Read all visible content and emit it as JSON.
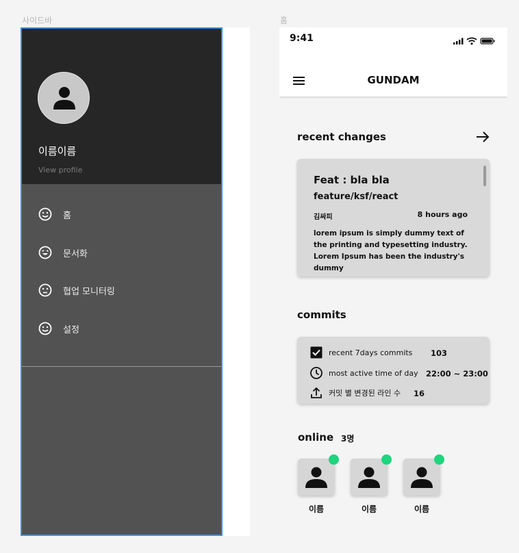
{
  "frames": {
    "sidebar_label": "사이드바",
    "home_label": "홈"
  },
  "sidebar": {
    "name": "이름이름",
    "view_profile": "View profile",
    "items": [
      {
        "label": "홈",
        "icon": "smile-icon"
      },
      {
        "label": "문서화",
        "icon": "smile-icon"
      },
      {
        "label": "협업 모니터링",
        "icon": "neutral-face-icon"
      },
      {
        "label": "설정",
        "icon": "smile-icon"
      }
    ]
  },
  "home": {
    "status_time": "9:41",
    "app_title": "GUNDAM",
    "recent": {
      "title": "recent changes",
      "card": {
        "commit_title": "Feat : bla bla",
        "branch": "feature/ksf/react",
        "author": "김싸피",
        "time": "8 hours ago",
        "body": "lorem ipsum is simply dummy text of the printing and typesetting industry. Lorem Ipsum has been the industry's dummy"
      }
    },
    "commits": {
      "title": "commits",
      "rows": [
        {
          "label": "recent 7days commits",
          "value": "103",
          "icon": "checkbox-icon"
        },
        {
          "label": "most active time of day",
          "value": "22:00 ~ 23:00",
          "icon": "clock-icon"
        },
        {
          "label": "커밋 별 변경된 라인 수",
          "value": "16",
          "icon": "upload-icon"
        }
      ]
    },
    "online": {
      "title": "online",
      "count": "3명",
      "users": [
        {
          "name": "이름"
        },
        {
          "name": "이름"
        },
        {
          "name": "이름"
        }
      ]
    }
  },
  "colors": {
    "sidebar_head": "#262626",
    "sidebar_body": "#525252",
    "selection_border": "#2f8ff0",
    "online_dot": "#1ed47d",
    "card_bg": "#d9d9d9"
  }
}
